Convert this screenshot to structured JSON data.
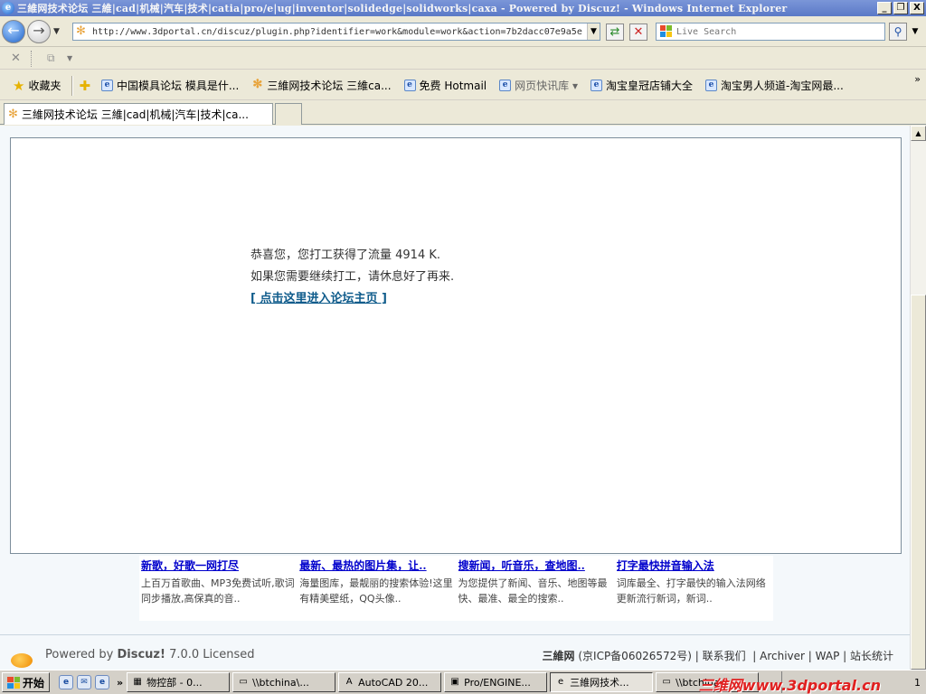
{
  "window": {
    "title": "三維网技术论坛 三維|cad|机械|汽车|技术|catia|pro/e|ug|inventor|solidedge|solidworks|caxa - Powered by Discuz! - Windows Internet Explorer",
    "buttons": {
      "minimize": "_",
      "maximize": "❐",
      "close": "X"
    }
  },
  "addressbar": {
    "url": "http://www.3dportal.cn/discuz/plugin.php?identifier=work&module=work&action=7b2dacc07e9a5e",
    "search_placeholder": "Live Search"
  },
  "favorites_bar": {
    "favorites_label": "收藏夹",
    "items": [
      {
        "label": "中国模具论坛 模具是什..."
      },
      {
        "label": "三維网技术论坛 三維ca..."
      },
      {
        "label": "免费 Hotmail"
      },
      {
        "label": "网页快讯库 ▾"
      },
      {
        "label": "淘宝皇冠店铺大全"
      },
      {
        "label": "淘宝男人频道-淘宝网最..."
      }
    ],
    "more": "»"
  },
  "tabs": [
    {
      "label": "三維网技术论坛 三維|cad|机械|汽车|技术|ca..."
    }
  ],
  "message": {
    "line1": "恭喜您，您打工获得了流量 4914 K.",
    "line2": "如果您需要继续打工，请休息好了再来.",
    "link": "[ 点击这里进入论坛主页 ]"
  },
  "ads": [
    {
      "title": "新歌，好歌一网打尽",
      "desc": "上百万首歌曲、MP3免费试听,歌词同步播放,高保真的音.."
    },
    {
      "title": "最新、最热的图片集，让..",
      "desc": "海量图库，最靓丽的搜索体验!这里有精美壁纸，QQ头像.."
    },
    {
      "title": "搜新闻，听音乐，查地图..",
      "desc": "为您提供了新闻、音乐、地图等最快、最准、最全的搜索.."
    },
    {
      "title": "打字最快拼音输入法",
      "desc": "词库最全、打字最快的输入法网络更新流行新词，新词.."
    }
  ],
  "footer": {
    "powered_prefix": "Powered by ",
    "powered_brand": "Discuz!",
    "powered_suffix": " 7.0.0 Licensed",
    "site": "三維网",
    "icp": "(京ICP备06026572号)",
    "links": [
      "联系我们",
      "Archiver",
      "WAP",
      "站长统计"
    ]
  },
  "taskbar": {
    "start": "开始",
    "chevron": "»",
    "tasks": [
      {
        "label": "物控部 - 0..."
      },
      {
        "label": "\\\\btchina\\..."
      },
      {
        "label": "AutoCAD 20..."
      },
      {
        "label": "Pro/ENGINE..."
      },
      {
        "label": "三維网技术..."
      },
      {
        "label": "\\\\btchina\\..."
      }
    ],
    "watermark": "三维网www.3dportal.cn",
    "clock": "1"
  }
}
